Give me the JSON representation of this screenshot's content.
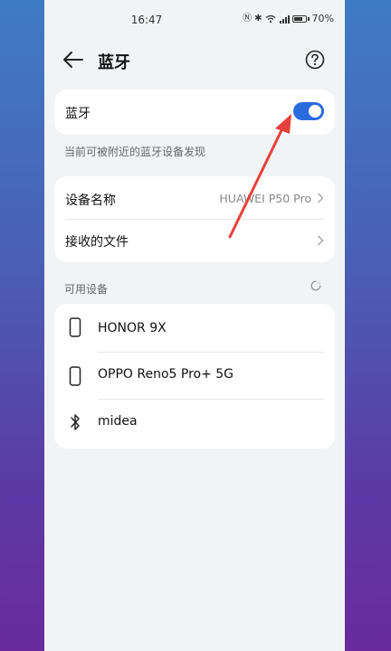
{
  "status": {
    "time": "16:47",
    "battery": "70%"
  },
  "header": {
    "title": "蓝牙"
  },
  "bluetooth": {
    "label": "蓝牙",
    "enabled": true,
    "caption": "当前可被附近的蓝牙设备发现"
  },
  "settings": {
    "device_name_label": "设备名称",
    "device_name_value": "HUAWEI P50 Pro",
    "received_files_label": "接收的文件"
  },
  "available": {
    "title": "可用设备",
    "devices": [
      {
        "name": "HONOR 9X",
        "icon": "phone-icon"
      },
      {
        "name": "OPPO Reno5 Pro+ 5G",
        "icon": "phone-icon"
      },
      {
        "name": "midea",
        "icon": "bluetooth-icon"
      }
    ]
  },
  "colors": {
    "accent": "#2a6be0",
    "annotation_arrow": "#e8403a"
  }
}
